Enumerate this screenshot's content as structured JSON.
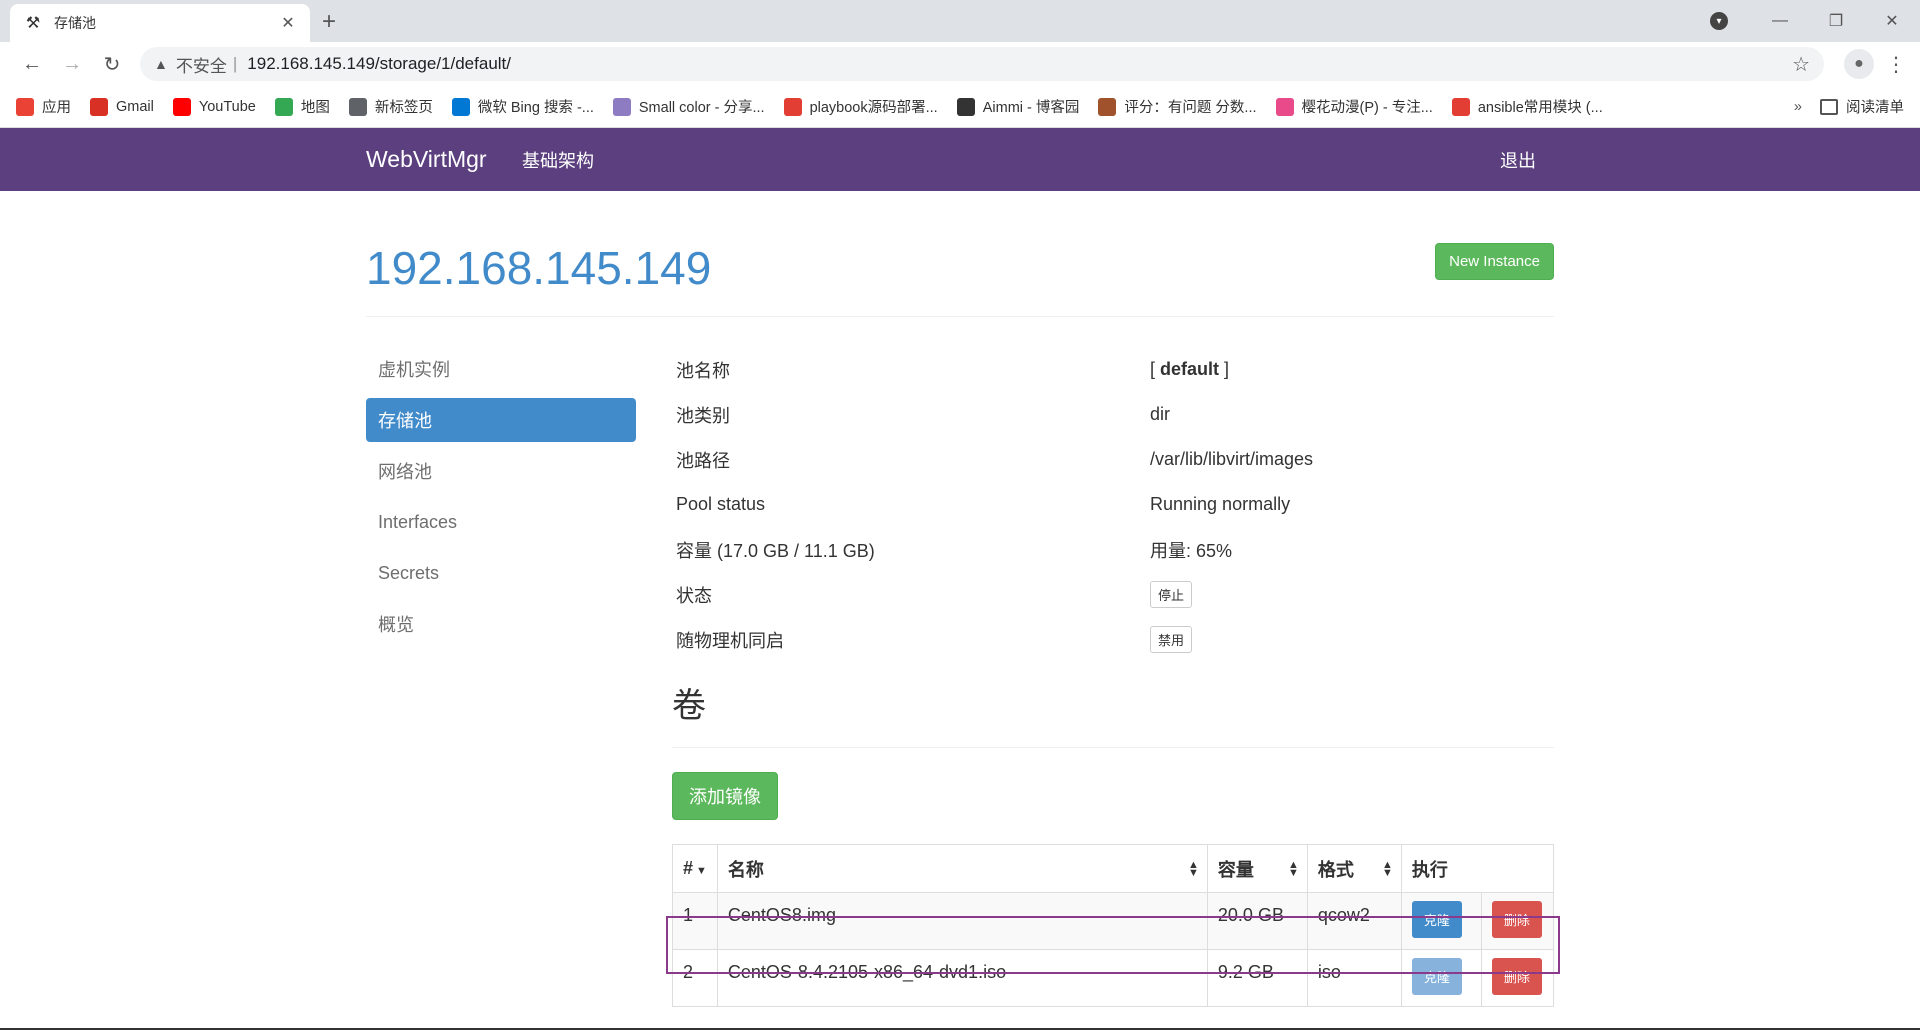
{
  "browser": {
    "tab_title": "存储池",
    "url_insecure_label": "不安全",
    "url_separator": "|",
    "url": "192.168.145.149/storage/1/default/",
    "bookmarks": [
      {
        "label": "应用",
        "icon": "apps-grid-icon",
        "color": "#ea4335"
      },
      {
        "label": "Gmail",
        "icon": "gmail-icon",
        "color": "#d93025"
      },
      {
        "label": "YouTube",
        "icon": "youtube-icon",
        "color": "#ff0000"
      },
      {
        "label": "地图",
        "icon": "maps-icon",
        "color": "#34a853"
      },
      {
        "label": "新标签页",
        "icon": "globe-icon",
        "color": "#5f6368"
      },
      {
        "label": "微软 Bing 搜索 -...",
        "icon": "bing-icon",
        "color": "#0078d4"
      },
      {
        "label": "Small color - 分享...",
        "icon": "smallcolor-icon",
        "color": "#8e7cc3"
      },
      {
        "label": "playbook源码部署...",
        "icon": "csdn-icon",
        "color": "#e33e33"
      },
      {
        "label": "Aimmi - 博客园",
        "icon": "cnblogs-icon",
        "color": "#333333"
      },
      {
        "label": "评分：有问题 分数...",
        "icon": "avatar-icon",
        "color": "#a0522d"
      },
      {
        "label": "樱花动漫(P) - 专注...",
        "icon": "sakura-icon",
        "color": "#e84a8a"
      },
      {
        "label": "ansible常用模块 (...",
        "icon": "csdn-icon",
        "color": "#e33e33"
      }
    ],
    "bookmarks_more": "»",
    "reading_list": "阅读清单"
  },
  "app": {
    "brand": "WebVirtMgr",
    "nav_infrastructure": "基础架构",
    "nav_logout": "退出",
    "page_title": "192.168.145.149",
    "new_instance_label": "New Instance",
    "sidebar": [
      {
        "label": "虚机实例",
        "active": false
      },
      {
        "label": "存储池",
        "active": true
      },
      {
        "label": "网络池",
        "active": false
      },
      {
        "label": "Interfaces",
        "active": false
      },
      {
        "label": "Secrets",
        "active": false
      },
      {
        "label": "概览",
        "active": false
      }
    ],
    "pool_info": {
      "name_label": "池名称",
      "name_value": "default",
      "type_label": "池类别",
      "type_value": "dir",
      "path_label": "池路径",
      "path_value": "/var/lib/libvirt/images",
      "status_label": "Pool status",
      "status_value": "Running normally",
      "capacity_label": "容量 (17.0 GB / 11.1 GB)",
      "usage_value": "用量: 65%",
      "state_label": "状态",
      "state_button": "停止",
      "autostart_label": "随物理机同启",
      "autostart_button": "禁用"
    },
    "volumes_title": "卷",
    "add_image_label": "添加镜像",
    "table": {
      "headers": [
        "#",
        "名称",
        "容量",
        "格式",
        "执行"
      ],
      "rows": [
        {
          "index": "1",
          "name": "CentOS8.img",
          "size": "20.0 GB",
          "format": "qcow2",
          "clone": "克隆",
          "delete": "删除"
        },
        {
          "index": "2",
          "name": "CentOS-8.4.2105-x86_64-dvd1.iso",
          "size": "9.2 GB",
          "format": "iso",
          "clone": "克隆",
          "delete": "删除"
        }
      ]
    }
  }
}
